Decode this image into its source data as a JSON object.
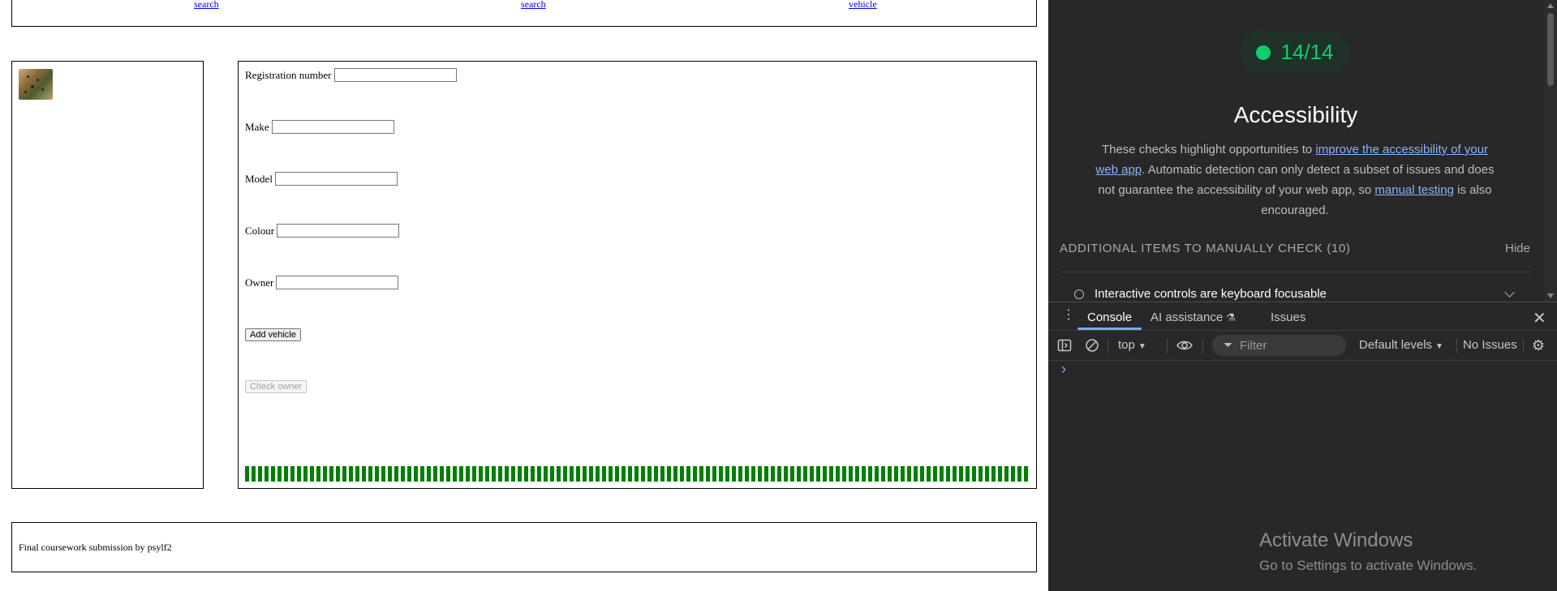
{
  "nav": {
    "links": [
      "search",
      "search",
      "vehicle"
    ]
  },
  "form": {
    "fields": [
      {
        "label": "Registration number",
        "value": ""
      },
      {
        "label": "Make",
        "value": ""
      },
      {
        "label": "Model",
        "value": ""
      },
      {
        "label": "Colour",
        "value": ""
      },
      {
        "label": "Owner",
        "value": ""
      }
    ],
    "add_button": "Add vehicle",
    "check_button": "Check owner"
  },
  "progress": {
    "value": 1.0,
    "color": "#008000"
  },
  "footer": {
    "text": "Final coursework submission by psylf2"
  },
  "devtools": {
    "score": "14/14",
    "score_color": "#0cce6b",
    "title": "Accessibility",
    "desc_1": "These checks highlight opportunities to ",
    "desc_link_1": "improve the accessibility of your web app",
    "desc_2": ". Automatic detection can only detect a subset of issues and does not guarantee the accessibility of your web app, so ",
    "desc_link_2": "manual testing",
    "desc_3": " is also encouraged.",
    "manual_header": "ADDITIONAL ITEMS TO MANUALLY CHECK (10)",
    "hide": "Hide",
    "audit_item": "Interactive controls are keyboard focusable",
    "tabs": [
      "Console",
      "AI assistance",
      "Issues"
    ],
    "context": "top",
    "filter_placeholder": "Filter",
    "levels": "Default levels",
    "issues": "No Issues",
    "prompt": "›"
  },
  "watermark": {
    "title": "Activate Windows",
    "subtitle": "Go to Settings to activate Windows."
  }
}
